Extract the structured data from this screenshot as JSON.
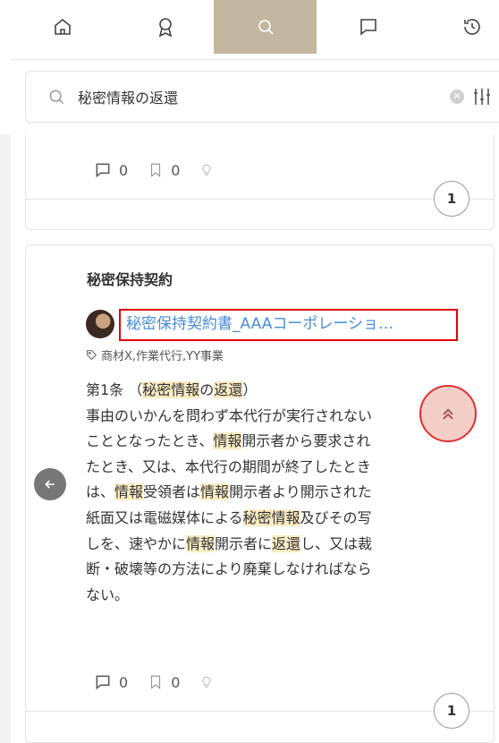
{
  "nav": {
    "items": [
      {
        "name": "home",
        "icon": "home-icon"
      },
      {
        "name": "badge",
        "icon": "ribbon-icon"
      },
      {
        "name": "search",
        "icon": "search-icon",
        "active": true
      },
      {
        "name": "comments",
        "icon": "chat-icon"
      },
      {
        "name": "history",
        "icon": "history-icon"
      }
    ],
    "active_color": "#c3b7a1"
  },
  "search": {
    "value": "秘密情報の返還",
    "clear_icon": "clear-icon",
    "filter_icon": "filter-sliders-icon"
  },
  "card1": {
    "comments": "0",
    "bookmarks": "0",
    "badge": "1"
  },
  "card2": {
    "title": "秘密保持契約",
    "document": "秘密保持契約書_AAAコーポレーショ…",
    "tags": "商材X,作業代行,YY事業",
    "comments": "0",
    "bookmarks": "0",
    "badge": "1",
    "body": [
      [
        {
          "t": "第1条 （"
        },
        {
          "t": "秘密情報",
          "h": true
        },
        {
          "t": "の"
        },
        {
          "t": "返還",
          "h": true
        },
        {
          "t": "）"
        }
      ],
      [
        {
          "t": "事由のいかんを問わず本代行が実行されない"
        }
      ],
      [
        {
          "t": "こととなったとき、"
        },
        {
          "t": "情報",
          "h": true
        },
        {
          "t": "開示者から要求され"
        }
      ],
      [
        {
          "t": "たとき、又は、本代行の期間が終了したとき"
        }
      ],
      [
        {
          "t": "は、"
        },
        {
          "t": "情報",
          "h": true
        },
        {
          "t": "受領者は"
        },
        {
          "t": "情報",
          "h": true
        },
        {
          "t": "開示者より開示された"
        }
      ],
      [
        {
          "t": "紙面又は電磁媒体による"
        },
        {
          "t": "秘密情報",
          "h": true
        },
        {
          "t": "及びその写"
        }
      ],
      [
        {
          "t": "しを、速やかに"
        },
        {
          "t": "情報",
          "h": true
        },
        {
          "t": "開示者に"
        },
        {
          "t": "返還",
          "h": true
        },
        {
          "t": "し、又は裁"
        }
      ],
      [
        {
          "t": "断・破壊等の方法により廃棄しなければなら"
        }
      ],
      [
        {
          "t": "ない。"
        }
      ]
    ]
  },
  "colors": {
    "highlight": "#fbecc4",
    "link": "#4a8cd6",
    "annotation": "#e00000"
  }
}
